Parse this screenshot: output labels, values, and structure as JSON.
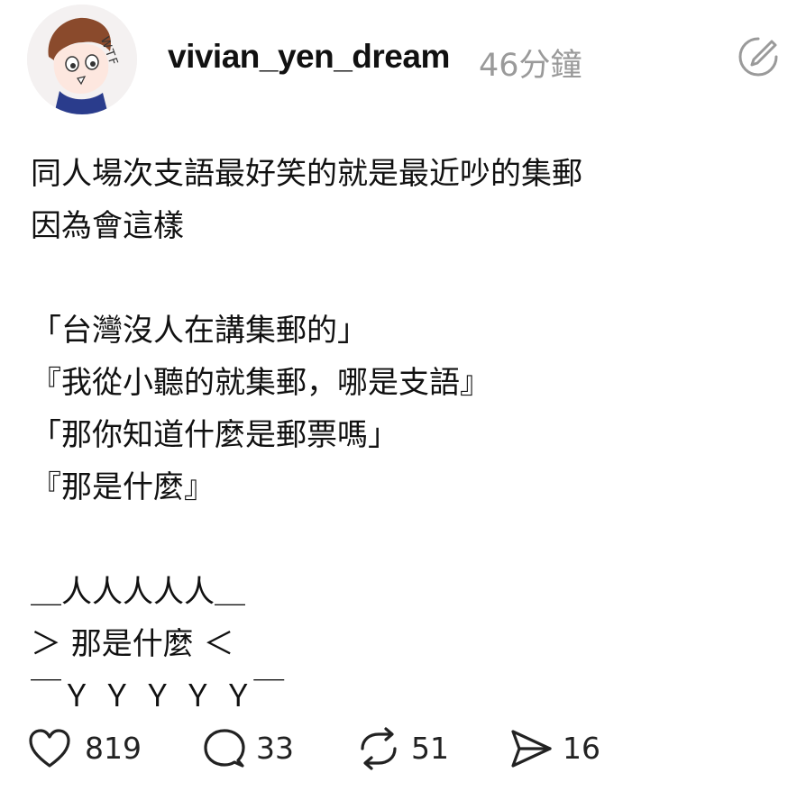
{
  "post": {
    "author": "vivian_yen_dream",
    "time_ago": "46分鐘",
    "avatar_text": "WTF",
    "lines": [
      "同人場次支語最好笑的就是最近吵的集郵",
      "因為會這樣",
      "",
      "「台灣沒人在講集郵的」",
      "『我從小聽的就集郵，哪是支語』",
      "「那你知道什麼是郵票嗎」",
      "『那是什麼』",
      "",
      "＿人人人人人＿",
      "＞ 那是什麼 ＜",
      "￣Ｙ Ｙ Ｙ Ｙ Ｙ￣"
    ]
  },
  "actions": {
    "likes": "819",
    "comments": "33",
    "reposts": "51",
    "shares": "16"
  },
  "icons": {
    "edit": "edit-pencil-circle-icon",
    "like": "heart-icon",
    "comment": "comment-bubble-icon",
    "repost": "repost-arrows-icon",
    "share": "send-paper-plane-icon"
  },
  "colors": {
    "text": "#111111",
    "muted": "#9a9a9a",
    "icon": "#222222"
  }
}
